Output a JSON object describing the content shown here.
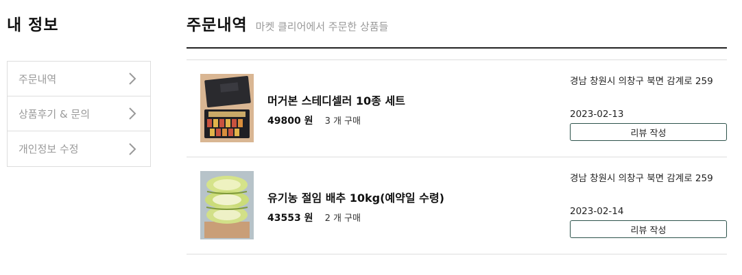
{
  "sidebar": {
    "title": "내 정보",
    "items": [
      {
        "label": "주문내역"
      },
      {
        "label": "상품후기 & 문의"
      },
      {
        "label": "개인정보 수정"
      }
    ]
  },
  "main": {
    "title": "주문내역",
    "subtitle": "마켓 클리어에서 주문한 상품들"
  },
  "orders": [
    {
      "image": "gift-box-product-image",
      "name": "머거본 스테디셀러 10종 세트",
      "price": "49800 원",
      "quantity": "3 개 구매",
      "address": "경남 창원시 의창구 북면 감계로 259",
      "date": "2023-02-13",
      "review_label": "리뷰 작성"
    },
    {
      "image": "salted-cabbage-product-image",
      "name": "유기농 절임 배추 10kg(예약일 수령)",
      "price": "43553 원",
      "quantity": "2 개 구매",
      "address": "경남 창원시 의창구 북면 감계로 259",
      "date": "2023-02-14",
      "review_label": "리뷰 작성"
    }
  ],
  "colors": {
    "accent": "#2b5149",
    "muted_text": "#999999",
    "border": "#dddddd"
  }
}
